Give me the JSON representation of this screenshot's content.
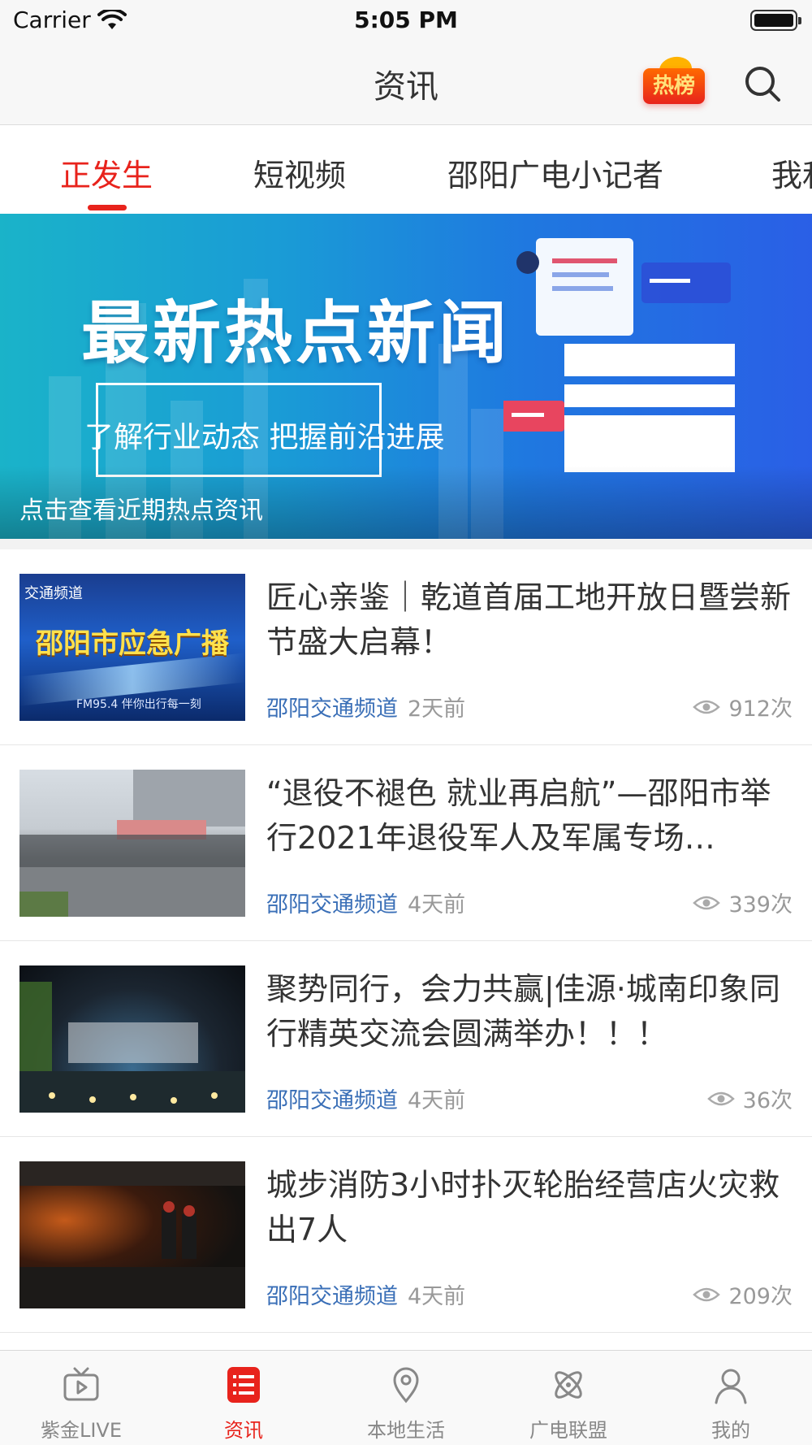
{
  "status_bar": {
    "carrier": "Carrier",
    "time": "5:05 PM"
  },
  "nav": {
    "title": "资讯",
    "hot_badge_label": "热榜"
  },
  "tabs": [
    {
      "label": "正发生",
      "active": true
    },
    {
      "label": "短视频",
      "active": false
    },
    {
      "label": "邵阳广电小记者",
      "active": false
    },
    {
      "label": "我和",
      "active": false
    }
  ],
  "banner": {
    "headline": "最新热点新闻",
    "subtitle": "了解行业动态 把握前沿进展",
    "caption": "点击查看近期热点资讯"
  },
  "news": [
    {
      "title": "匠心亲鉴｜乾道首届工地开放日暨尝新节盛大启幕！",
      "source": "邵阳交通频道",
      "time": "2天前",
      "views": "912次",
      "thumb_text": "邵阳市应急广播",
      "thumb_logo": "交通频道",
      "thumb_footer": "FM95.4 伴你出行每一刻"
    },
    {
      "title": "“退役不褪色 就业再启航”—邵阳市举行2021年退役军人及军属专场…",
      "source": "邵阳交通频道",
      "time": "4天前",
      "views": "339次"
    },
    {
      "title": "聚势同行，会力共赢|佳源·城南印象同行精英交流会圆满举办！！！",
      "source": "邵阳交通频道",
      "time": "4天前",
      "views": "36次"
    },
    {
      "title": "城步消防3小时扑灭轮胎经营店火灾救出7人",
      "source": "邵阳交通频道",
      "time": "4天前",
      "views": "209次"
    }
  ],
  "tab_bar": [
    {
      "label": "紫金LIVE",
      "icon": "tv-icon",
      "active": false
    },
    {
      "label": "资讯",
      "icon": "news-list-icon",
      "active": true
    },
    {
      "label": "本地生活",
      "icon": "location-pin-icon",
      "active": false
    },
    {
      "label": "广电联盟",
      "icon": "atom-icon",
      "active": false
    },
    {
      "label": "我的",
      "icon": "user-icon",
      "active": false
    }
  ],
  "colors": {
    "accent": "#e8231c",
    "source_link": "#3a6fb7",
    "muted": "#999999"
  }
}
